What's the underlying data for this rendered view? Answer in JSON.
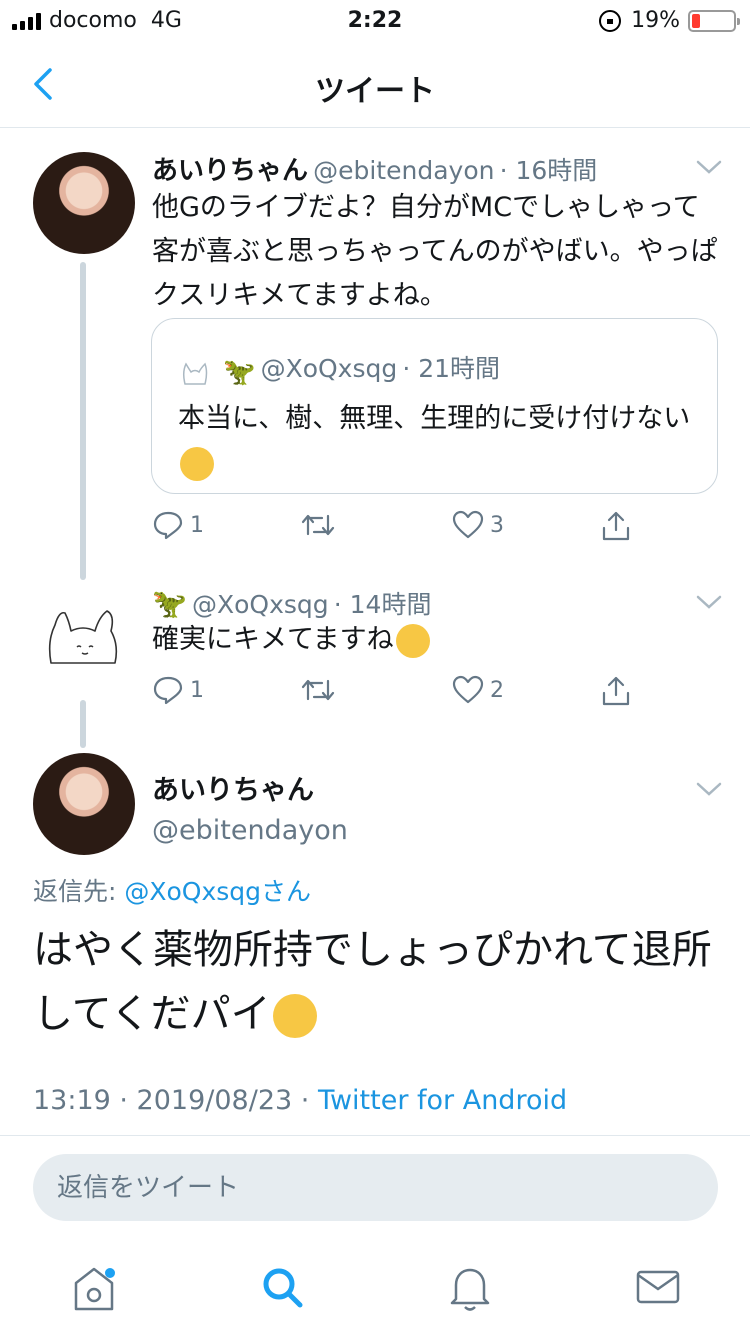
{
  "status_bar": {
    "carrier": "docomo",
    "network": "4G",
    "time": "2:22",
    "battery": "19%",
    "battery_level": 0.19
  },
  "nav": {
    "title": "ツイート"
  },
  "tweet1": {
    "name": "あいりちゃん",
    "handle": "@ebitendayon",
    "time": "· 16時間",
    "text": "他Gのライブだよ？自分がMCでしゃしゃって客が喜ぶと思っちゃってんのがやばい。やっぱクスリキメてますよね。",
    "quote": {
      "handle": "@XoQxsqg",
      "time": "· 21時間",
      "text": "本当に、樹、無理、生理的に受け付けない"
    },
    "replies": "1",
    "retweets": "",
    "likes": "3"
  },
  "tweet2": {
    "handle": "@XoQxsqg",
    "time": "· 14時間",
    "text": "確実にキメてますね",
    "replies": "1",
    "retweets": "",
    "likes": "2"
  },
  "main_tweet": {
    "name": "あいりちゃん",
    "handle": "@ebitendayon",
    "reply_label": "返信先: ",
    "reply_target": "@XoQxsqgさん",
    "text": "はやく薬物所持でしょっぴかれて退所してくだパイ",
    "timestamp": "13:19 · 2019/08/23 · ",
    "source": "Twitter for Android"
  },
  "compose": {
    "placeholder": "返信をツイート"
  },
  "tabbar": {
    "items": [
      "home-icon",
      "search-icon",
      "notifications-icon",
      "messages-icon"
    ],
    "accent": "#1da1f2"
  }
}
